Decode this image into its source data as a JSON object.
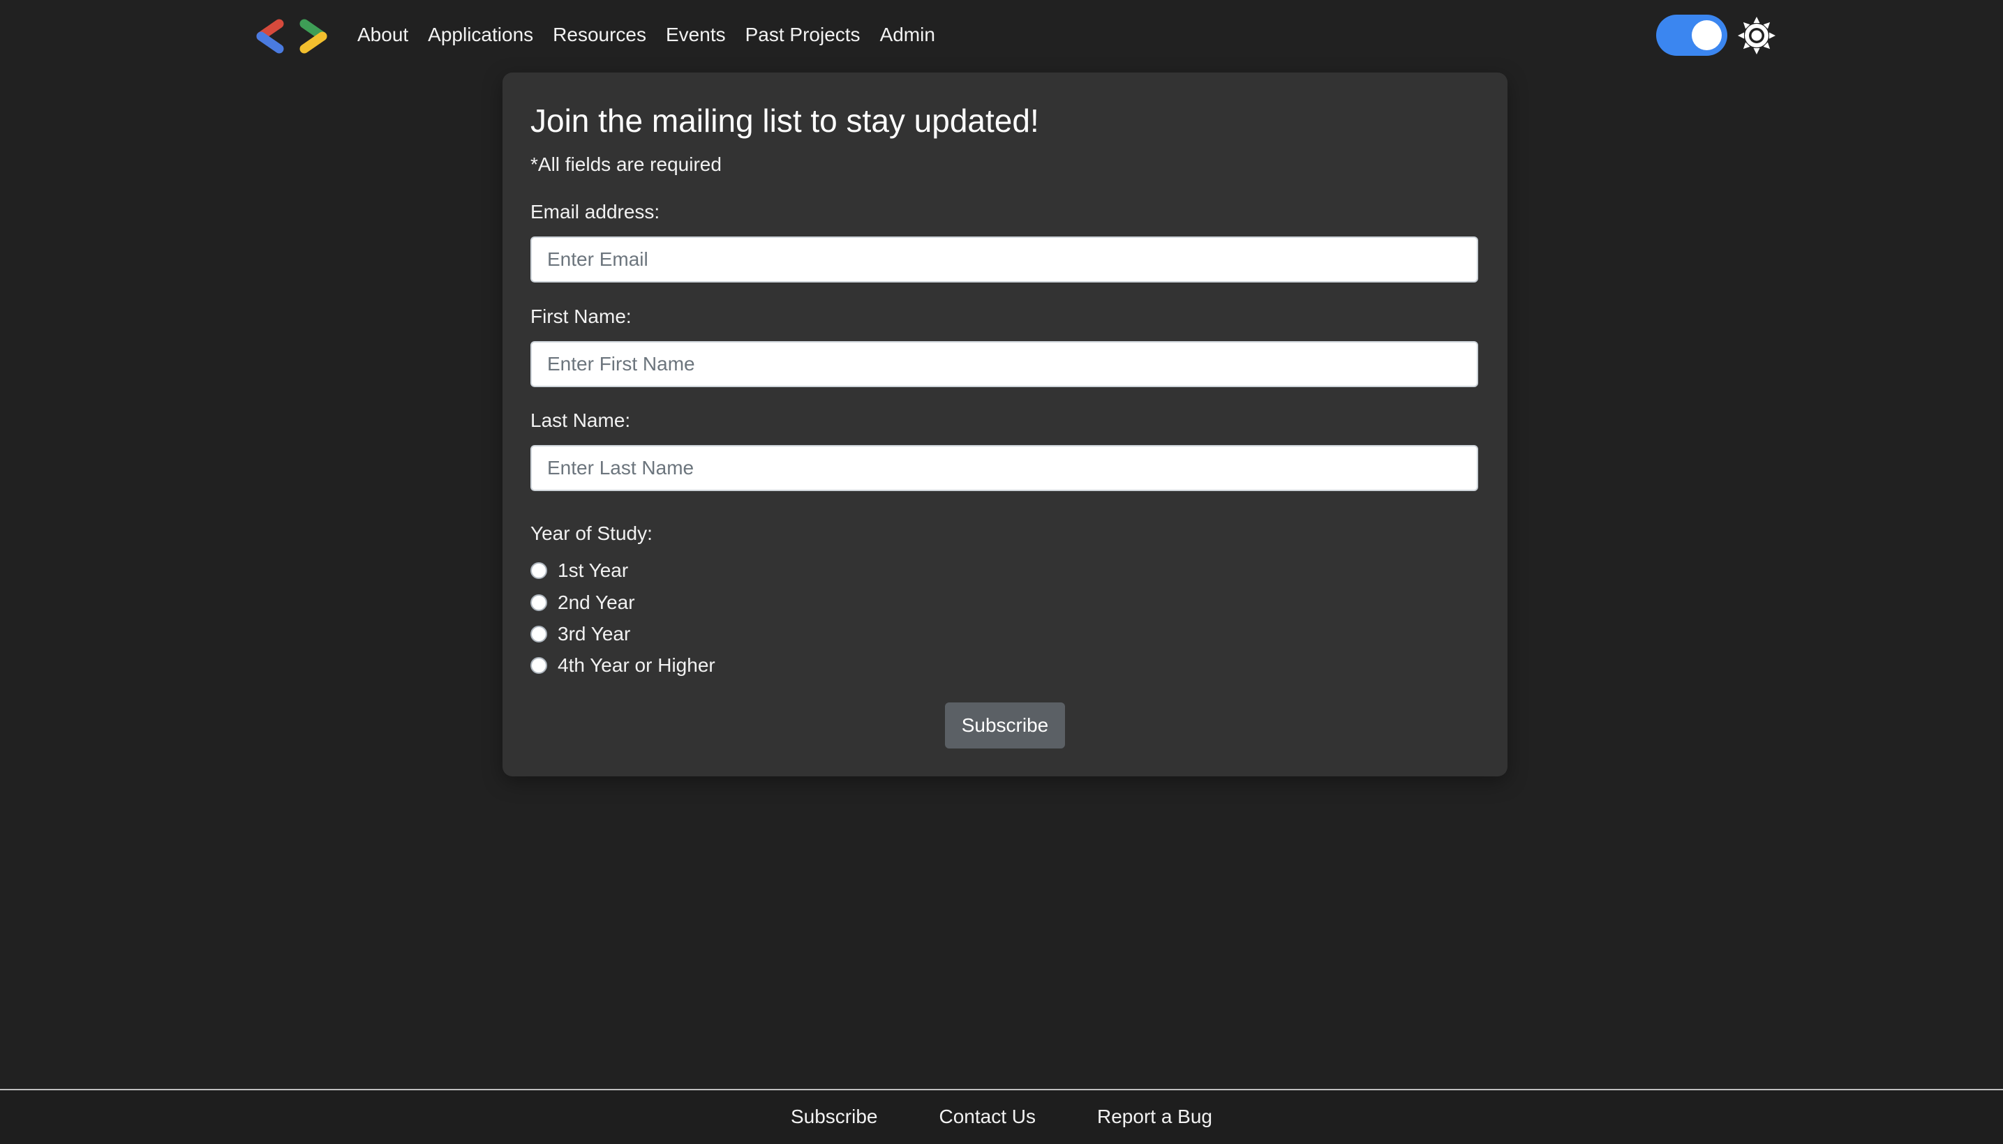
{
  "nav": {
    "logo_icon": "code-brackets-logo-icon",
    "logo_colors": [
      "#4a7be0",
      "#d64a3c",
      "#3e9e56",
      "#f2bf2e"
    ],
    "links": [
      "About",
      "Applications",
      "Resources",
      "Events",
      "Past Projects",
      "Admin"
    ],
    "theme_toggle": {
      "on": true,
      "color": "#3b86f0"
    },
    "theme_icon": "sun-icon"
  },
  "form": {
    "title": "Join the mailing list to stay updated!",
    "required_note": "*All fields are required",
    "email": {
      "label": "Email address:",
      "placeholder": "Enter Email",
      "value": ""
    },
    "first_name": {
      "label": "First Name:",
      "placeholder": "Enter First Name",
      "value": ""
    },
    "last_name": {
      "label": "Last Name:",
      "placeholder": "Enter Last Name",
      "value": ""
    },
    "year_of_study": {
      "label": "Year of Study:",
      "options": [
        "1st Year",
        "2nd Year",
        "3rd Year",
        "4th Year or Higher"
      ],
      "selected": null
    },
    "submit_label": "Subscribe"
  },
  "footer": {
    "links": [
      "Subscribe",
      "Contact Us",
      "Report a Bug"
    ]
  },
  "colors": {
    "background": "#212121",
    "card": "#333333",
    "button": "#5b6065",
    "text": "#ffffff"
  }
}
